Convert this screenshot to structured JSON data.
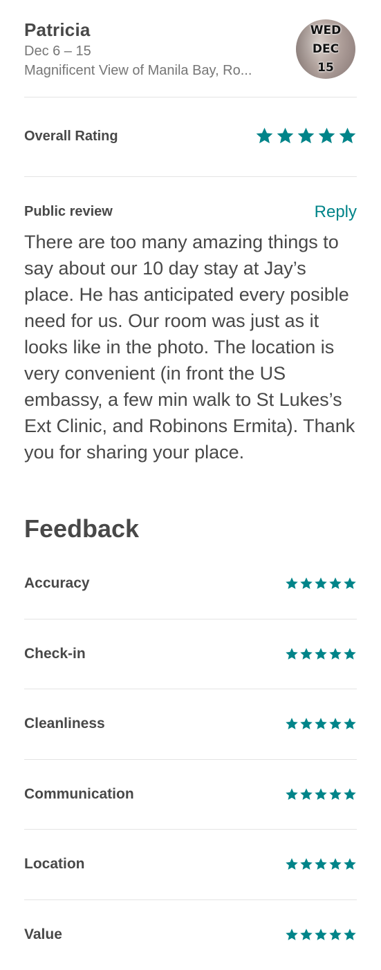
{
  "reservation": {
    "guest_name": "Patricia",
    "dates": "Dec 6 – 15",
    "listing_title": "Magnificent View of Manila Bay, Ro...",
    "badge": {
      "weekday": "WED",
      "month": "DEC",
      "day": "15"
    }
  },
  "overall_rating": {
    "label": "Overall Rating",
    "stars": 5
  },
  "public_review": {
    "label": "Public review",
    "reply_label": "Reply",
    "text": "There are too many amazing things to say about our 10 day stay at Jay’s place. He has anticipated every posible need for us. Our room was just as it looks like in the photo.  The location is very convenient (in front the US embassy, a few min walk to St Lukes’s Ext Clinic, and Robinons Ermita). Thank you for sharing your place."
  },
  "feedback": {
    "title": "Feedback",
    "items": [
      {
        "label": "Accuracy",
        "stars": 5
      },
      {
        "label": "Check-in",
        "stars": 5
      },
      {
        "label": "Cleanliness",
        "stars": 5
      },
      {
        "label": "Communication",
        "stars": 5
      },
      {
        "label": "Location",
        "stars": 5
      },
      {
        "label": "Value",
        "stars": 5
      }
    ]
  },
  "colors": {
    "accent": "#008489",
    "text_primary": "#484848",
    "text_secondary": "#767676",
    "divider": "#e4e4e4"
  },
  "icons": {
    "star": "star-icon",
    "avatar": "guest-avatar-photo"
  }
}
